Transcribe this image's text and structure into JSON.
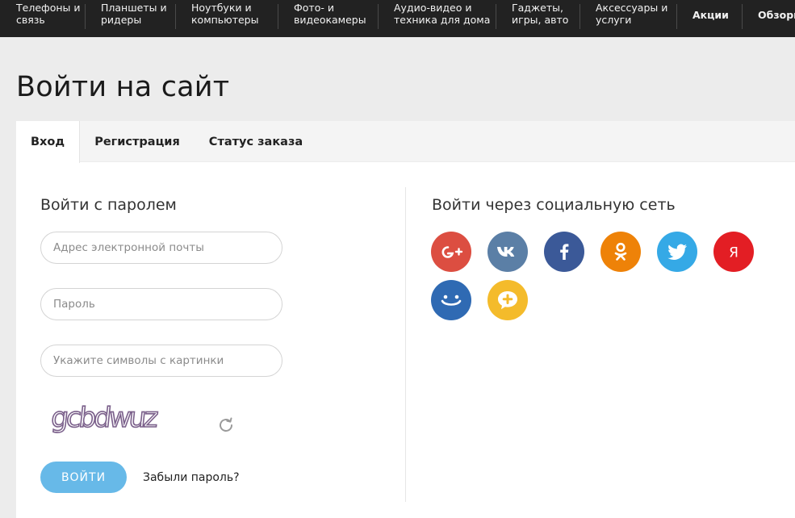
{
  "nav": {
    "items": [
      {
        "label": "Телефоны и\nсвязь",
        "bold": false
      },
      {
        "label": "Планшеты и\nридеры",
        "bold": false
      },
      {
        "label": "Ноутбуки и\nкомпьютеры",
        "bold": false
      },
      {
        "label": "Фото- и\nвидеокамеры",
        "bold": false
      },
      {
        "label": "Аудио-видео и\nтехника для дома",
        "bold": false
      },
      {
        "label": "Гаджеты,\nигры, авто",
        "bold": false
      },
      {
        "label": "Аксессуары и\nуслуги",
        "bold": false
      },
      {
        "label": "Акции",
        "bold": true
      },
      {
        "label": "Обзоры",
        "bold": true
      }
    ]
  },
  "page": {
    "title": "Войти на сайт"
  },
  "tabs": [
    {
      "label": "Вход",
      "active": true
    },
    {
      "label": "Регистрация",
      "active": false
    },
    {
      "label": "Статус заказа",
      "active": false
    }
  ],
  "login": {
    "title": "Войти с паролем",
    "email_placeholder": "Адрес электронной почты",
    "password_placeholder": "Пароль",
    "captcha_placeholder": "Укажите символы с картинки",
    "captcha_text": "gcbdwuz",
    "submit_label": "ВОЙТИ",
    "forgot_label": "Забыли пароль?"
  },
  "social": {
    "title": "Войти через социальную сеть",
    "networks": [
      {
        "name": "google-plus",
        "glyph": "G+",
        "color": "#dc4e41"
      },
      {
        "name": "vkontakte",
        "glyph": "vk",
        "color": "#5b7fa6"
      },
      {
        "name": "facebook",
        "glyph": "f",
        "color": "#3b5998"
      },
      {
        "name": "odnoklassniki",
        "glyph": "ok",
        "color": "#ee8208"
      },
      {
        "name": "twitter",
        "glyph": "bird",
        "color": "#35a9e6"
      },
      {
        "name": "yandex",
        "glyph": "Я",
        "color": "#e31e24"
      },
      {
        "name": "mail-ru",
        "glyph": "smile",
        "color": "#2f6ab3"
      },
      {
        "name": "chat",
        "glyph": "plus-bubble",
        "color": "#f4bb2b"
      }
    ]
  }
}
